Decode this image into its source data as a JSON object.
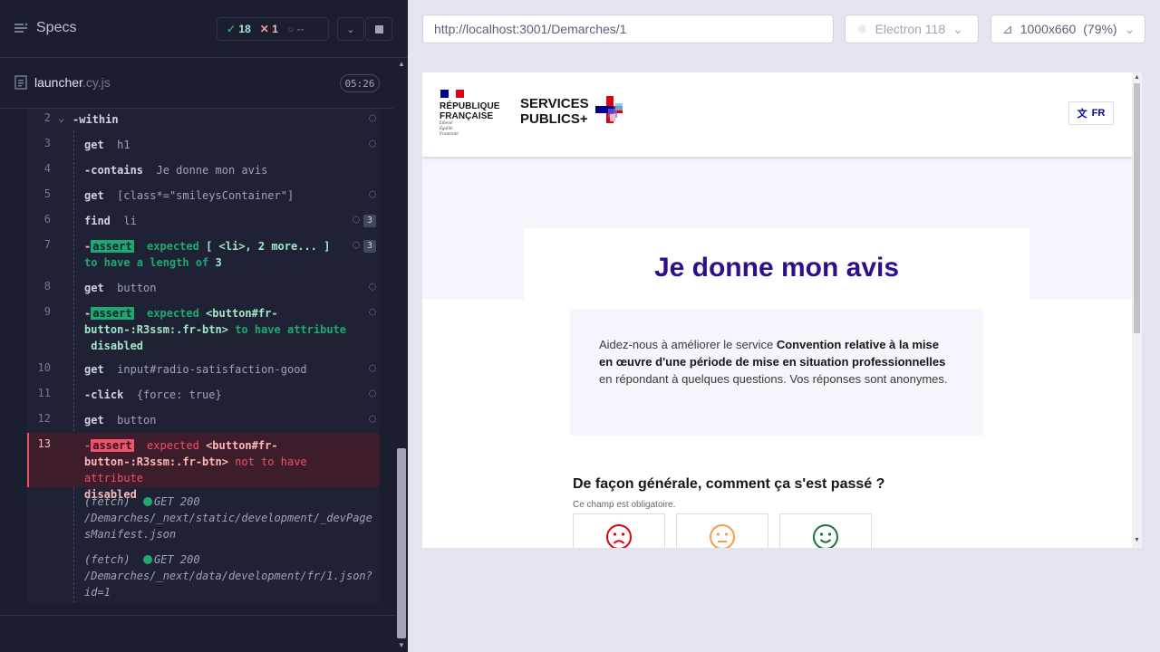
{
  "runner": {
    "header": {
      "title": "Specs",
      "passed": "18",
      "failed": "1",
      "pending": "--"
    },
    "file": {
      "name": "launcher",
      "ext": ".cy.js",
      "duration": "05:26"
    },
    "commands": [
      {
        "num": "2",
        "name": "-within",
        "arg": ""
      },
      {
        "num": "3",
        "name": "get",
        "arg": "h1"
      },
      {
        "num": "4",
        "name": "-contains",
        "arg": "Je donne mon avis"
      },
      {
        "num": "5",
        "name": "get",
        "arg": "[class*=\"smileysContainer\"]"
      },
      {
        "num": "6",
        "name": "find",
        "arg": "li",
        "count": "3"
      },
      {
        "num": "7",
        "badge": "assert",
        "line1": "expected",
        "line1b": "[ <li>, 2 more... ]",
        "line2": "to have a length of",
        "line2b": "3",
        "count": "3"
      },
      {
        "num": "8",
        "name": "get",
        "arg": "button"
      },
      {
        "num": "9",
        "badge": "assert",
        "line1": "expected",
        "line1b": "<button#fr-",
        "line2": "button-:R3ssm:.fr-btn>",
        "line2b": "to have attribute",
        "line3": "disabled"
      },
      {
        "num": "10",
        "name": "get",
        "arg": "input#radio-satisfaction-good"
      },
      {
        "num": "11",
        "name": "-click",
        "arg": "{force: true}"
      },
      {
        "num": "12",
        "name": "get",
        "arg": "button"
      },
      {
        "num": "13",
        "badge": "assert",
        "line1": "expected",
        "line1b": "<button#fr-",
        "line2": "button-:R3ssm:.fr-btn>",
        "line2b": "not to have attribute",
        "line3": "disabled"
      }
    ],
    "fetches": [
      {
        "label": "(fetch)",
        "status": "GET 200",
        "url1": "/Demarches/_next/static/development/_devPage",
        "url2": "sManifest.json"
      },
      {
        "label": "(fetch)",
        "status": "GET 200",
        "url1": "/Demarches/_next/data/development/fr/1.json?",
        "url2": "id=1"
      }
    ]
  },
  "preview": {
    "url": "http://localhost:3001/Demarches/1",
    "browser": "Electron 118",
    "viewport": "1000x660",
    "zoom": "(79%)"
  },
  "site": {
    "rf_line1": "RÉPUBLIQUE",
    "rf_line2": "FRANÇAISE",
    "rf_motto1": "Liberté",
    "rf_motto2": "Égalité",
    "rf_motto3": "Fraternité",
    "sp_line1": "SERVICES",
    "sp_line2": "PUBLICS+",
    "lang": "FR",
    "title": "Je donne mon avis",
    "intro_before": "Aidez-nous à améliorer le service ",
    "intro_bold": "Convention relative à la mise en œuvre d'une période de mise en situation professionnelles",
    "intro_after": " en répondant à quelques questions. Vos réponses sont anonymes.",
    "question": "De façon générale, comment ça s'est passé ?",
    "hint": "Ce champ est obligatoire."
  },
  "colors": {
    "pass": "#1fa971",
    "fail": "#f0516a",
    "brand_blue": "#000091",
    "title_purple": "#2e0f8a",
    "smiley_bad": "#e1000f",
    "smiley_neutral": "#ff9940",
    "smiley_good": "#18753c"
  }
}
